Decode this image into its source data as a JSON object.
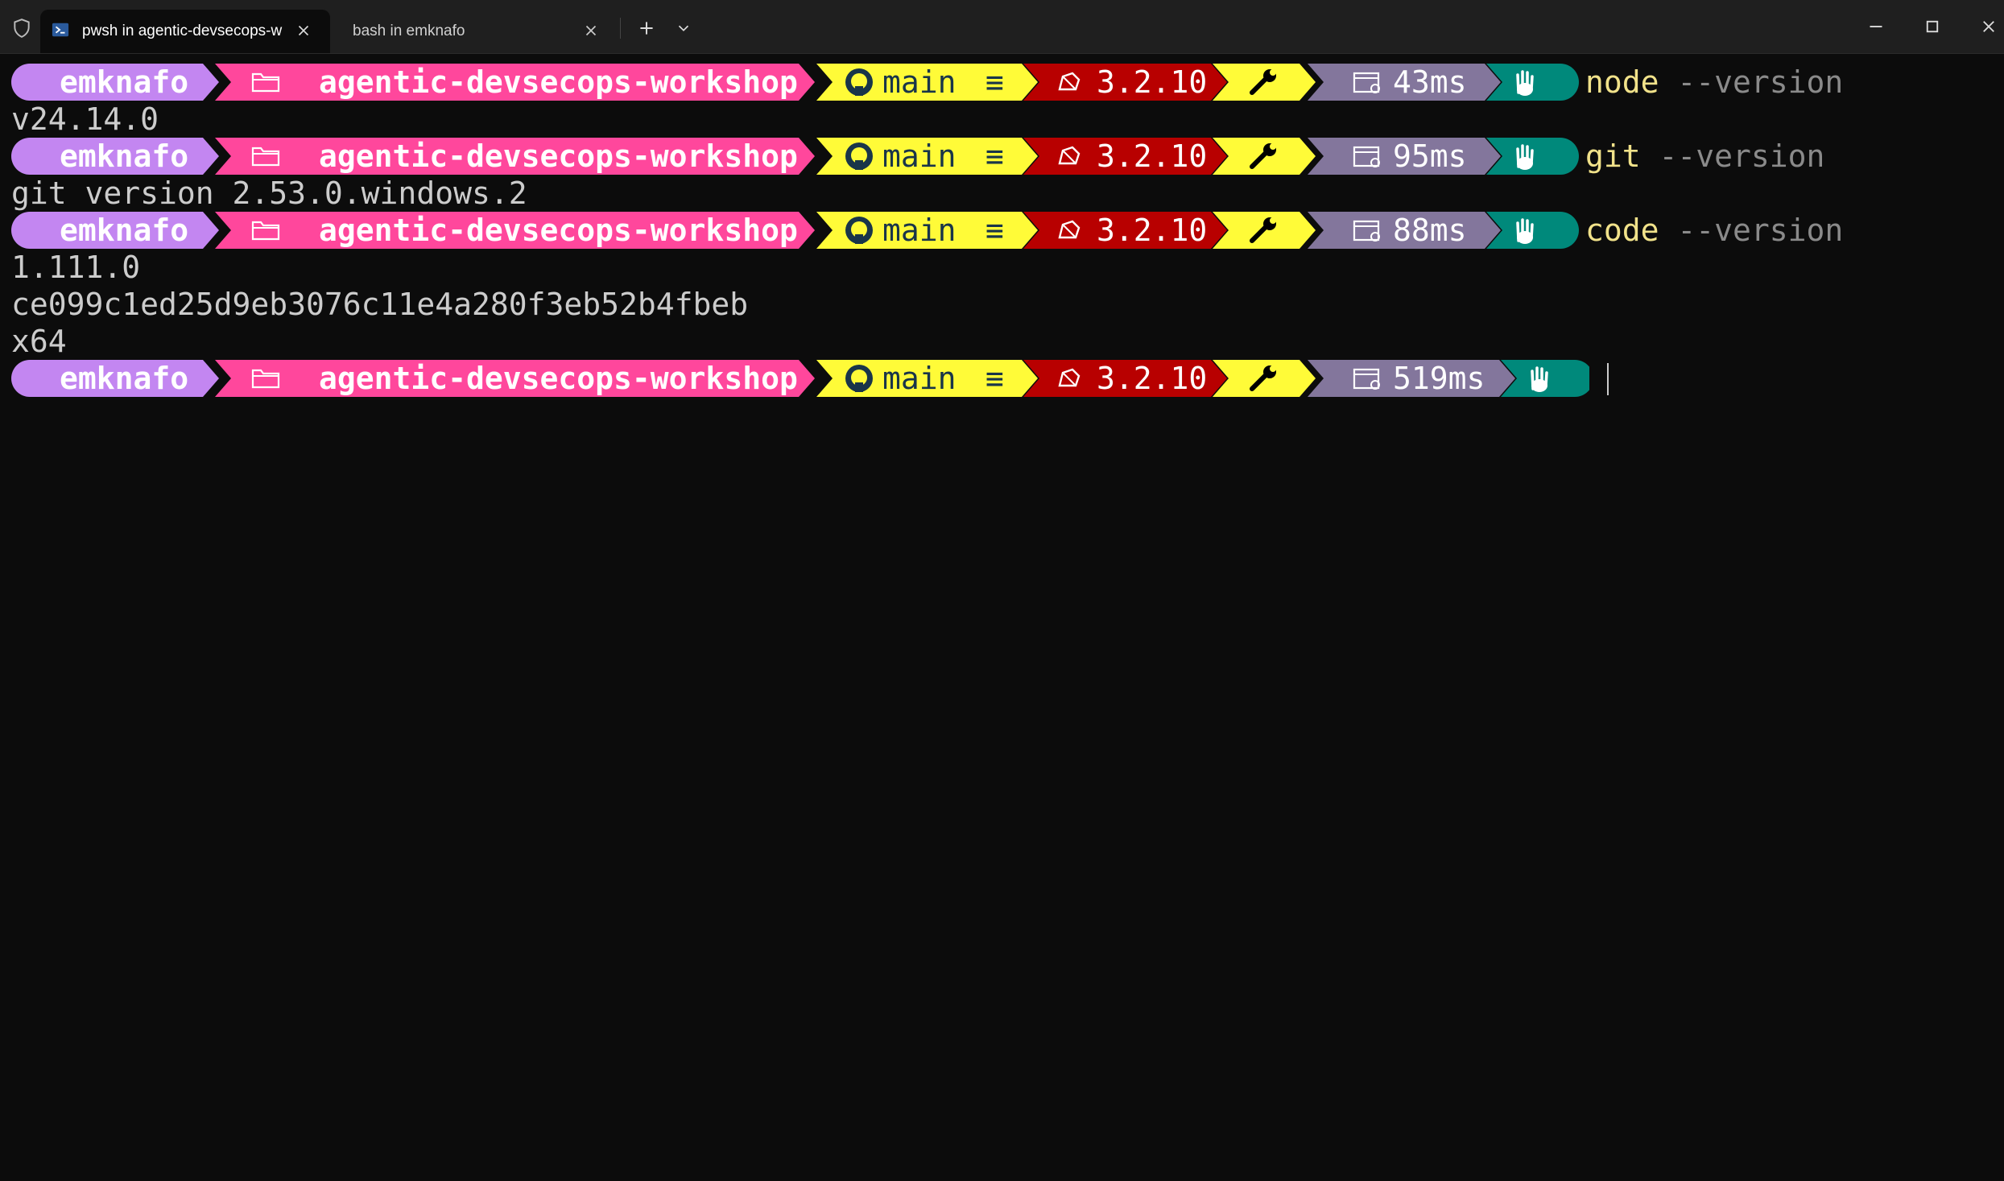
{
  "window": {
    "tabs": [
      {
        "label": "pwsh in agentic-devsecops-w",
        "active": true
      },
      {
        "label": "bash in emknafo",
        "active": false
      }
    ],
    "icons": {
      "shield": "shield-icon",
      "powershell": "powershell-icon",
      "close": "close-icon",
      "new_tab": "plus-icon",
      "dropdown": "chevron-down-icon",
      "minimize": "minimize-icon",
      "maximize": "maximize-icon",
      "window_close": "close-icon"
    }
  },
  "prompt_segments": {
    "user": "emknafo",
    "path": "agentic-devsecops-workshop",
    "branch": "main",
    "branch_status": "≡",
    "ruby_version": "3.2.10",
    "colors": {
      "user": "#c386f1",
      "path": "#ff479c",
      "git": "#fffb38",
      "ruby": "#b80000",
      "tool": "#fffb38",
      "time": "#83769c",
      "shell": "#00897b"
    }
  },
  "session": [
    {
      "elapsed": "43ms",
      "command": "node",
      "args": "--version",
      "output": [
        "v24.14.0"
      ]
    },
    {
      "elapsed": "95ms",
      "command": "git",
      "args": "--version",
      "output": [
        "git version 2.53.0.windows.2"
      ]
    },
    {
      "elapsed": "88ms",
      "command": "code",
      "args": "--version",
      "output": [
        "1.111.0",
        "ce099c1ed25d9eb3076c11e4a280f3eb52b4fbeb",
        "x64"
      ]
    },
    {
      "elapsed": "519ms",
      "command": "",
      "args": "",
      "output": []
    }
  ]
}
